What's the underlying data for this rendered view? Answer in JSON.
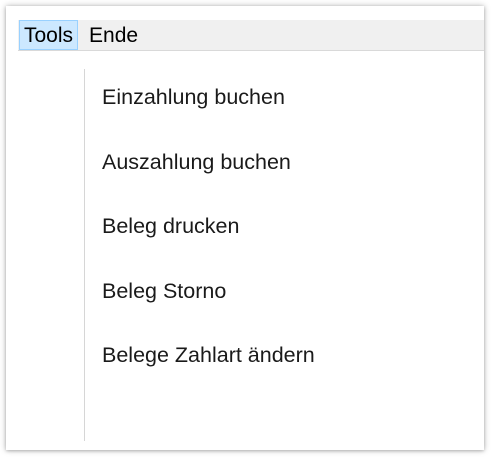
{
  "menubar": {
    "items": [
      {
        "label": "Tools"
      },
      {
        "label": "Ende"
      }
    ]
  },
  "tools_menu": {
    "items": [
      {
        "label": "Einzahlung buchen"
      },
      {
        "label": "Auszahlung buchen"
      },
      {
        "label": "Beleg drucken"
      },
      {
        "label": "Beleg Storno"
      },
      {
        "label": "Belege Zahlart ändern"
      }
    ]
  },
  "colors": {
    "menubar_bg": "#f0f0f0",
    "active_menu_bg": "#cce8ff",
    "active_menu_border": "#99d1ff"
  }
}
